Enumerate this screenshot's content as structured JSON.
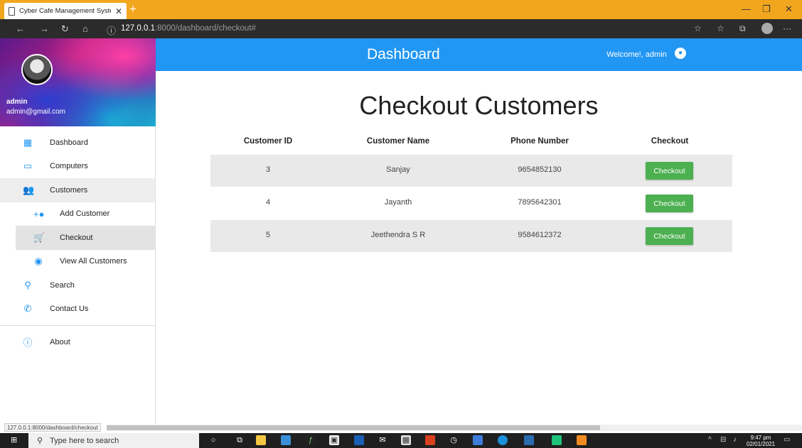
{
  "browser": {
    "tab_title": "Cyber Cafe Management System",
    "url_host": "127.0.0.1",
    "url_rest": ":8000/dashboard/checkout#",
    "status_url": "127.0.0.1:8000/dashboard/checkout"
  },
  "user": {
    "name": "admin",
    "email": "admin@gmail.com"
  },
  "sidebar": {
    "items": [
      {
        "label": "Dashboard",
        "icon": "dashboard-icon"
      },
      {
        "label": "Computers",
        "icon": "monitor-icon"
      },
      {
        "label": "Customers",
        "icon": "people-icon"
      },
      {
        "label": "Add Customer",
        "icon": "add-person-icon"
      },
      {
        "label": "Checkout",
        "icon": "cart-icon"
      },
      {
        "label": "View All Customers",
        "icon": "eye-icon"
      },
      {
        "label": "Search",
        "icon": "search-icon"
      },
      {
        "label": "Contact Us",
        "icon": "phone-icon"
      },
      {
        "label": "About",
        "icon": "info-icon"
      }
    ]
  },
  "header": {
    "title": "Dashboard",
    "welcome": "Welcome!, admin"
  },
  "main": {
    "title": "Checkout Customers",
    "columns": [
      "Customer ID",
      "Customer Name",
      "Phone Number",
      "Checkout"
    ],
    "rows": [
      {
        "id": "3",
        "name": "Sanjay",
        "phone": "9654852130",
        "action": "Checkout"
      },
      {
        "id": "4",
        "name": "Jayanth",
        "phone": "7895642301",
        "action": "Checkout"
      },
      {
        "id": "5",
        "name": "Jeethendra S R",
        "phone": "9584612372",
        "action": "Checkout"
      }
    ]
  },
  "taskbar": {
    "search_placeholder": "Type here to search",
    "time": "9:47 pm",
    "date": "02/01/2021"
  },
  "colors": {
    "primary": "#2196f3",
    "success": "#4caf50",
    "titlebar": "#f2a61e"
  }
}
